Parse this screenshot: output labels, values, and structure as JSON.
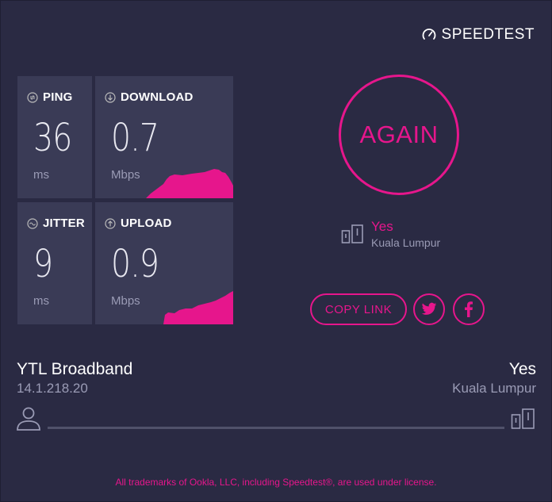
{
  "brand": {
    "logo_text": "SPEEDTEST",
    "icon": "gauge-icon"
  },
  "metrics": {
    "ping": {
      "label": "PING",
      "value": "36",
      "unit": "ms",
      "icon": "ping-icon"
    },
    "download": {
      "label": "DOWNLOAD",
      "value": "0.7",
      "unit": "Mbps",
      "icon": "download-arrow-icon"
    },
    "jitter": {
      "label": "JITTER",
      "value": "9",
      "unit": "ms",
      "icon": "jitter-icon"
    },
    "upload": {
      "label": "UPLOAD",
      "value": "0.9",
      "unit": "Mbps",
      "icon": "upload-arrow-icon"
    }
  },
  "actions": {
    "again_label": "AGAIN",
    "copy_link_label": "COPY LINK",
    "twitter_icon": "twitter-icon",
    "facebook_icon": "facebook-icon"
  },
  "server": {
    "name": "Yes",
    "location": "Kuala Lumpur",
    "icon": "server-icon"
  },
  "isp": {
    "name": "YTL Broadband",
    "ip": "14.1.218.20",
    "icon": "person-icon"
  },
  "host": {
    "name": "Yes",
    "location": "Kuala Lumpur"
  },
  "footer": {
    "text": "All trademarks of Ookla, LLC, including Speedtest®, are used under license."
  },
  "colors": {
    "accent": "#e6168c",
    "background": "#2a2a43",
    "tile": "#3a3b56",
    "muted": "#9a9bb5"
  }
}
